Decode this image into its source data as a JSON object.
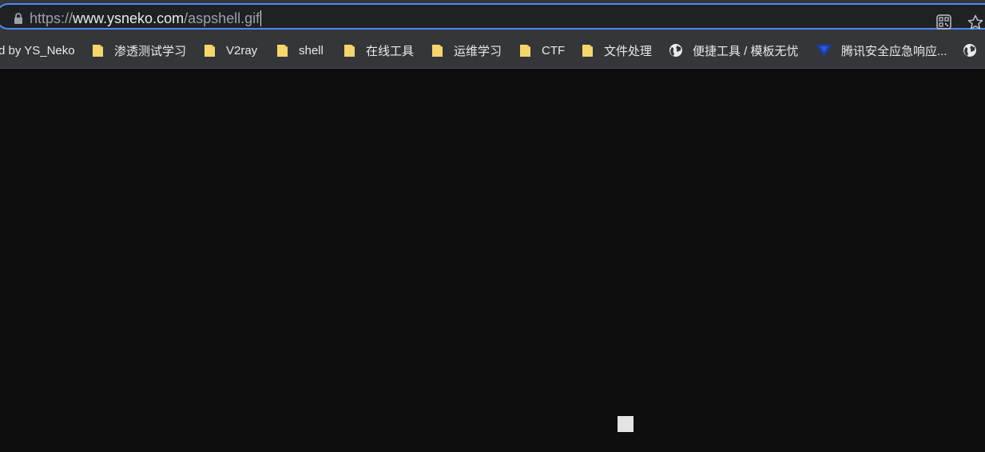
{
  "address_bar": {
    "scheme": "https://",
    "host": "www.ysneko.com",
    "path": "/aspshell.gif"
  },
  "icons": {
    "lock": "lock-icon",
    "qr": "qr-code-icon",
    "star": "star-icon",
    "folder": "folder-icon",
    "globe": "globe-icon",
    "tencent": "tencent-favicon"
  },
  "bookmarks": [
    {
      "label": "d by YS_Neko",
      "icon": "none"
    },
    {
      "label": "渗透测试学习",
      "icon": "folder"
    },
    {
      "label": "V2ray",
      "icon": "folder"
    },
    {
      "label": "shell",
      "icon": "folder"
    },
    {
      "label": "在线工具",
      "icon": "folder"
    },
    {
      "label": "运维学习",
      "icon": "folder"
    },
    {
      "label": "CTF",
      "icon": "folder"
    },
    {
      "label": "文件处理",
      "icon": "folder"
    },
    {
      "label": "便捷工具 / 模板无忧",
      "icon": "globe"
    },
    {
      "label": "腾讯安全应急响应...",
      "icon": "tencent"
    },
    {
      "label": "",
      "icon": "globe"
    }
  ],
  "colors": {
    "chrome_bg": "#35363a",
    "omnibox_bg": "#202124",
    "focus_ring": "#4a8af4",
    "page_bg": "#0e0e0e",
    "folder": "#f5d66c",
    "tencent": "#1a3fb0"
  }
}
